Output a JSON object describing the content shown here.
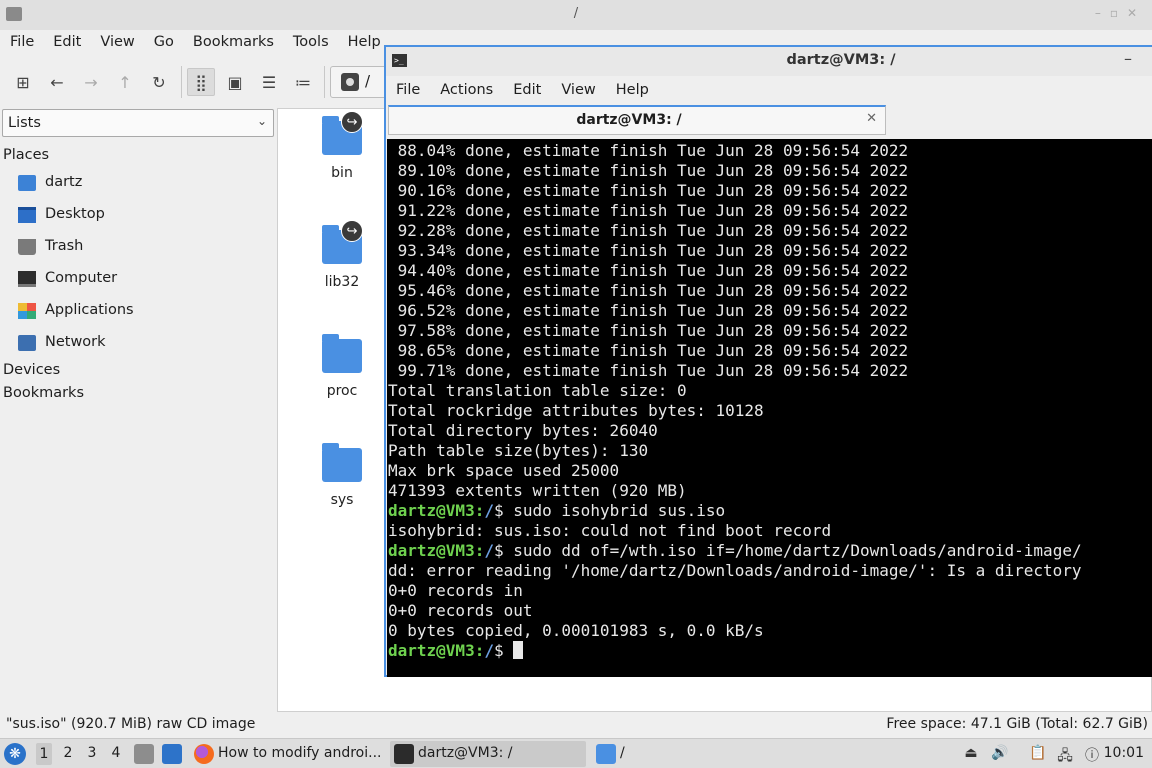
{
  "file_manager": {
    "title": "/",
    "menu": [
      "File",
      "Edit",
      "View",
      "Go",
      "Bookmarks",
      "Tools",
      "Help"
    ],
    "path": "/",
    "side_select": "Lists",
    "places_header": "Places",
    "places": [
      "dartz",
      "Desktop",
      "Trash",
      "Computer",
      "Applications",
      "Network"
    ],
    "devices_header": "Devices",
    "bookmarks_header": "Bookmarks",
    "files": [
      {
        "name": "bin",
        "symlink": true
      },
      {
        "name": "lib32",
        "symlink": true
      },
      {
        "name": "proc",
        "symlink": false
      },
      {
        "name": "sys",
        "symlink": false
      }
    ],
    "status_left": "\"sus.iso\" (920.7 MiB) raw CD image",
    "status_right": "Free space: 47.1 GiB (Total: 62.7 GiB)"
  },
  "terminal": {
    "title": "dartz@VM3: /",
    "menu": [
      "File",
      "Actions",
      "Edit",
      "View",
      "Help"
    ],
    "tab_label": "dartz@VM3: /",
    "lines": [
      {
        "text": " 88.04% done, estimate finish Tue Jun 28 09:56:54 2022"
      },
      {
        "text": " 89.10% done, estimate finish Tue Jun 28 09:56:54 2022"
      },
      {
        "text": " 90.16% done, estimate finish Tue Jun 28 09:56:54 2022"
      },
      {
        "text": " 91.22% done, estimate finish Tue Jun 28 09:56:54 2022"
      },
      {
        "text": " 92.28% done, estimate finish Tue Jun 28 09:56:54 2022"
      },
      {
        "text": " 93.34% done, estimate finish Tue Jun 28 09:56:54 2022"
      },
      {
        "text": " 94.40% done, estimate finish Tue Jun 28 09:56:54 2022"
      },
      {
        "text": " 95.46% done, estimate finish Tue Jun 28 09:56:54 2022"
      },
      {
        "text": " 96.52% done, estimate finish Tue Jun 28 09:56:54 2022"
      },
      {
        "text": " 97.58% done, estimate finish Tue Jun 28 09:56:54 2022"
      },
      {
        "text": " 98.65% done, estimate finish Tue Jun 28 09:56:54 2022"
      },
      {
        "text": " 99.71% done, estimate finish Tue Jun 28 09:56:54 2022"
      },
      {
        "text": "Total translation table size: 0"
      },
      {
        "text": "Total rockridge attributes bytes: 10128"
      },
      {
        "text": "Total directory bytes: 26040"
      },
      {
        "text": "Path table size(bytes): 130"
      },
      {
        "text": "Max brk space used 25000"
      },
      {
        "text": "471393 extents written (920 MB)"
      },
      {
        "user": "dartz@VM3",
        "path": "/",
        "text": "$ sudo isohybrid sus.iso"
      },
      {
        "text": "isohybrid: sus.iso: could not find boot record"
      },
      {
        "user": "dartz@VM3",
        "path": "/",
        "text": "$ sudo dd of=/wth.iso if=/home/dartz/Downloads/android-image/"
      },
      {
        "text": "dd: error reading '/home/dartz/Downloads/android-image/': Is a directory"
      },
      {
        "text": "0+0 records in"
      },
      {
        "text": "0+0 records out"
      },
      {
        "text": "0 bytes copied, 0.000101983 s, 0.0 kB/s"
      },
      {
        "user": "dartz@VM3",
        "path": "/",
        "text": "$ ",
        "cursor": true
      }
    ]
  },
  "taskbar": {
    "workspaces": [
      "1",
      "2",
      "3",
      "4"
    ],
    "current_workspace": "1",
    "tasks": [
      {
        "label": "How to modify androi...",
        "icon": "firefox-icon"
      },
      {
        "label": "dartz@VM3: /",
        "icon": "terminal-icon"
      },
      {
        "label": "/",
        "icon": "folder-icon"
      }
    ],
    "clock": "10:01"
  },
  "colors": {
    "accent": "#4a90e2",
    "prompt_user": "#6fd24f",
    "prompt_path": "#6d9fe0",
    "terminal_bg": "#000000"
  }
}
